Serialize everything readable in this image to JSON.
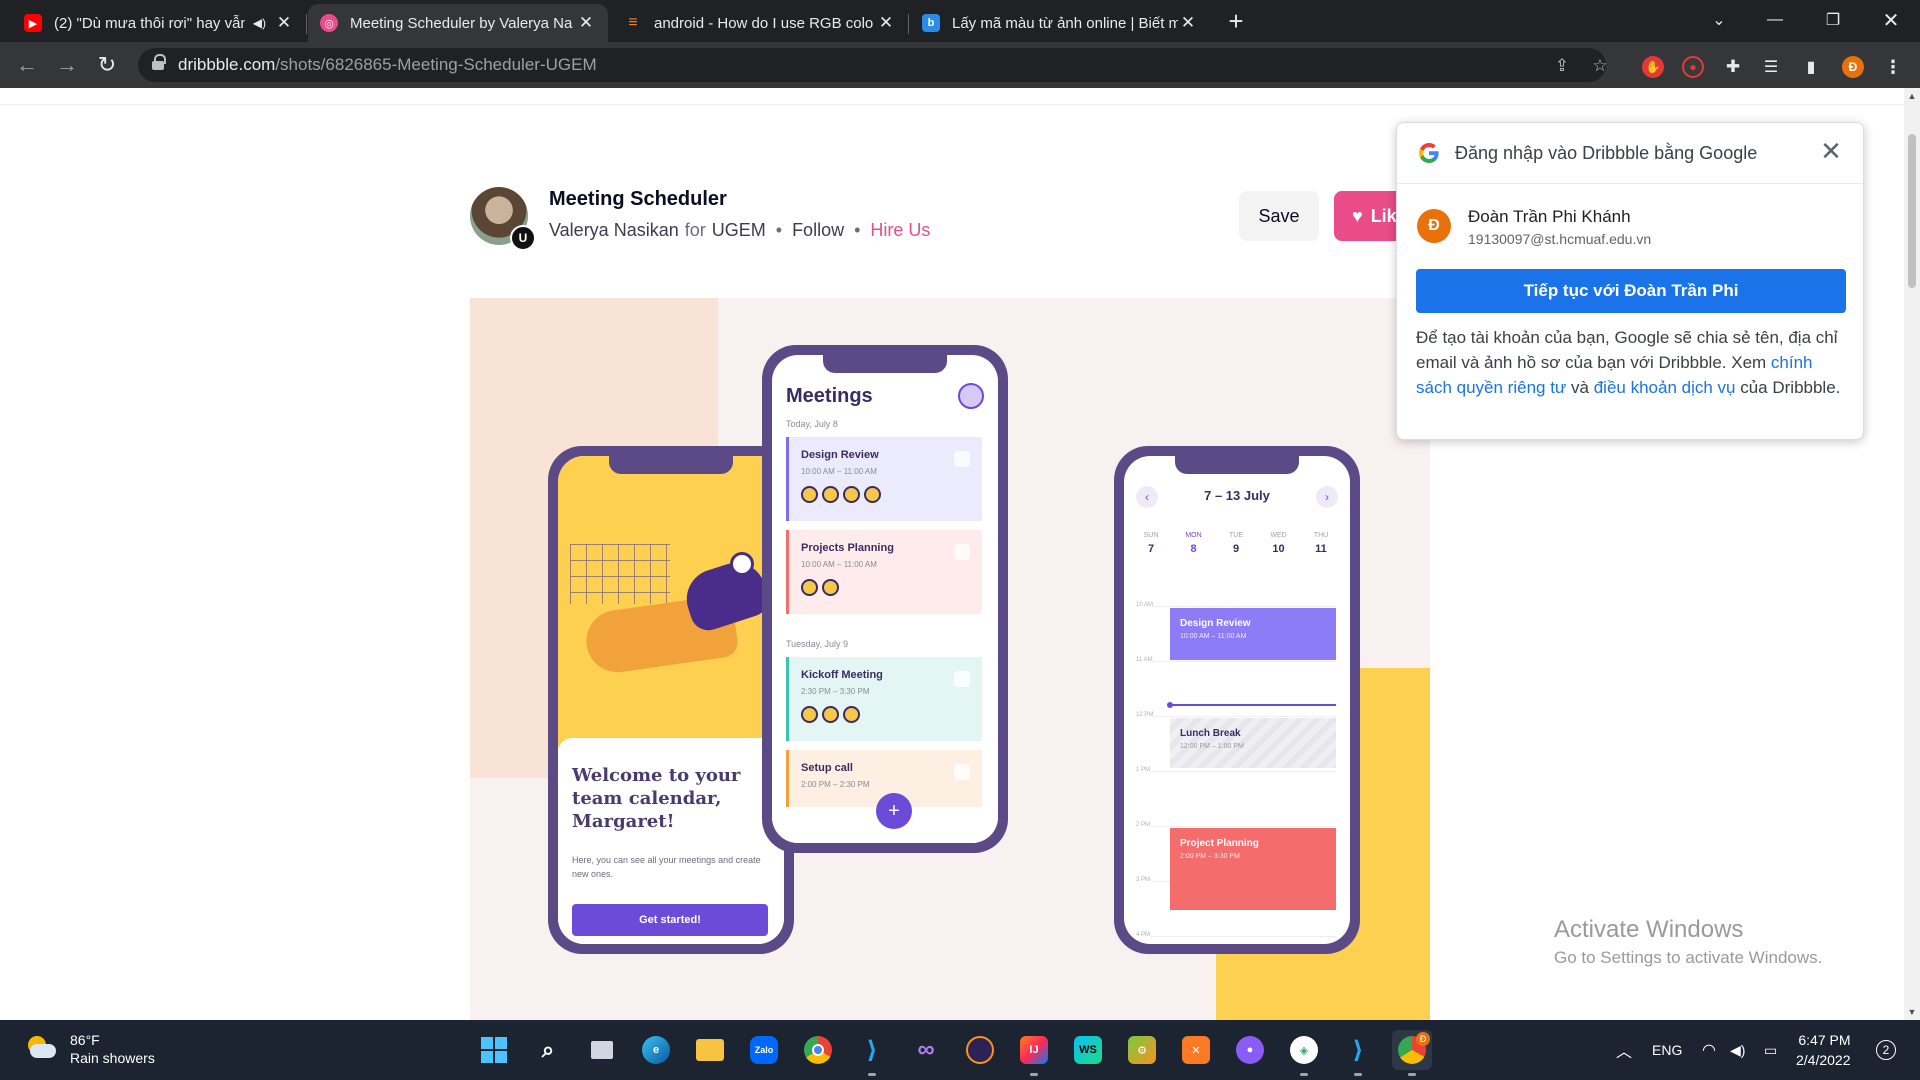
{
  "browser": {
    "tabs": [
      {
        "title": "(2) \"Dù mưa thôi rơi\" hay vẫn",
        "favicon": "youtube-icon",
        "color": "#ff0000",
        "audio": true
      },
      {
        "title": "Meeting Scheduler by Valerya Na",
        "favicon": "dribbble-icon",
        "color": "#ea4c89",
        "active": true
      },
      {
        "title": "android - How do I use RGB colo",
        "favicon": "stackoverflow-icon",
        "color": "#f48024"
      },
      {
        "title": "Lấy mã màu từ ảnh online | Biết m",
        "favicon": "b-icon",
        "color": "#2b8be6"
      }
    ],
    "url_domain": "dribbble.com",
    "url_path": "/shots/6826865-Meeting-Scheduler-UGEM",
    "profile_initial": "Đ"
  },
  "shot": {
    "title": "Meeting Scheduler",
    "author": "Valerya Nasikan",
    "for_label": "for",
    "team": "UGEM",
    "follow": "Follow",
    "hire": "Hire Us",
    "badge": "U",
    "save": "Save",
    "like": "Lik"
  },
  "phones": {
    "welcome": {
      "heading": "Welcome to your team calendar, Margaret!",
      "sub": "Here, you can see all your meetings and create new ones.",
      "cta": "Get started!"
    },
    "meetings": {
      "title": "Meetings",
      "day1": "Today, July 8",
      "day2": "Tuesday, July 9",
      "cards": [
        {
          "name": "Design Review",
          "time": "10:00 AM – 11:00 AM"
        },
        {
          "name": "Projects Planning",
          "time": "10:00 AM – 11:00 AM"
        },
        {
          "name": "Kickoff Meeting",
          "time": "2:30 PM – 3:30 PM"
        },
        {
          "name": "Setup call",
          "time": "2:00 PM – 2:30 PM"
        }
      ],
      "fab": "+"
    },
    "week": {
      "range": "7 – 13 July",
      "days": [
        {
          "name": "SUN",
          "num": "7"
        },
        {
          "name": "MON",
          "num": "8"
        },
        {
          "name": "TUE",
          "num": "9"
        },
        {
          "name": "WED",
          "num": "10"
        },
        {
          "name": "THU",
          "num": "11"
        }
      ],
      "hours": [
        "10 AM",
        "11 AM",
        "12 PM",
        "1 PM",
        "2 PM",
        "3 PM",
        "4 PM"
      ],
      "events": [
        {
          "name": "Design Review",
          "time": "10:00 AM – 11:00 AM"
        },
        {
          "name": "Lunch Break",
          "time": "12:00 PM – 1:00 PM"
        },
        {
          "name": "Project Planning",
          "time": "2:00 PM – 3:30 PM"
        }
      ]
    }
  },
  "google_popup": {
    "heading": "Đăng nhập vào Dribbble bằng Google",
    "account_initial": "Đ",
    "account_name": "Đoàn Trần Phi Khánh",
    "account_email": "19130097@st.hcmuaf.edu.vn",
    "continue": "Tiếp tục với Đoàn Trần Phi",
    "desc_1": "Để tạo tài khoản của bạn, Google sẽ chia sẻ tên, địa chỉ email và ảnh hồ sơ của bạn với Dribbble. Xem ",
    "privacy_link": "chính sách quyền riêng tư",
    "desc_and": " và ",
    "terms_link": "điều khoản dịch vụ",
    "desc_2": " của Dribbble."
  },
  "watermark": {
    "line1": "Activate Windows",
    "line2": "Go to Settings to activate Windows."
  },
  "taskbar": {
    "temperature": "86°F",
    "condition": "Rain showers",
    "language": "ENG",
    "time": "6:47 PM",
    "date": "2/4/2022",
    "notifications": "2",
    "zalo_label": "Zalo",
    "chrome_badge": "Đ"
  }
}
